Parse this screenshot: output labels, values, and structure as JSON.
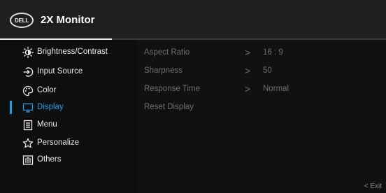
{
  "header": {
    "brand": "DELL",
    "title": "2X Monitor"
  },
  "menu": [
    {
      "label": "Brightness/Contrast",
      "icon": "brightness-icon"
    },
    {
      "label": "Input Source",
      "icon": "input-source-icon"
    },
    {
      "label": "Color",
      "icon": "color-palette-icon"
    },
    {
      "label": "Display",
      "icon": "display-icon",
      "active": true
    },
    {
      "label": "Menu",
      "icon": "menu-icon"
    },
    {
      "label": "Personalize",
      "icon": "star-icon"
    },
    {
      "label": "Others",
      "icon": "others-icon"
    }
  ],
  "submenu": [
    {
      "label": "Aspect Ratio",
      "arrow": ">",
      "value": "16 : 9"
    },
    {
      "label": "Sharpness",
      "arrow": ">",
      "value": "50"
    },
    {
      "label": "Response Time",
      "arrow": ">",
      "value": "Normal"
    },
    {
      "label": "Reset Display",
      "arrow": "",
      "value": ""
    }
  ],
  "footer": {
    "exit": "< Exit"
  },
  "colors": {
    "accent": "#1a9ee5",
    "background": "#0e0e0e",
    "header": "#1f1f1f"
  }
}
